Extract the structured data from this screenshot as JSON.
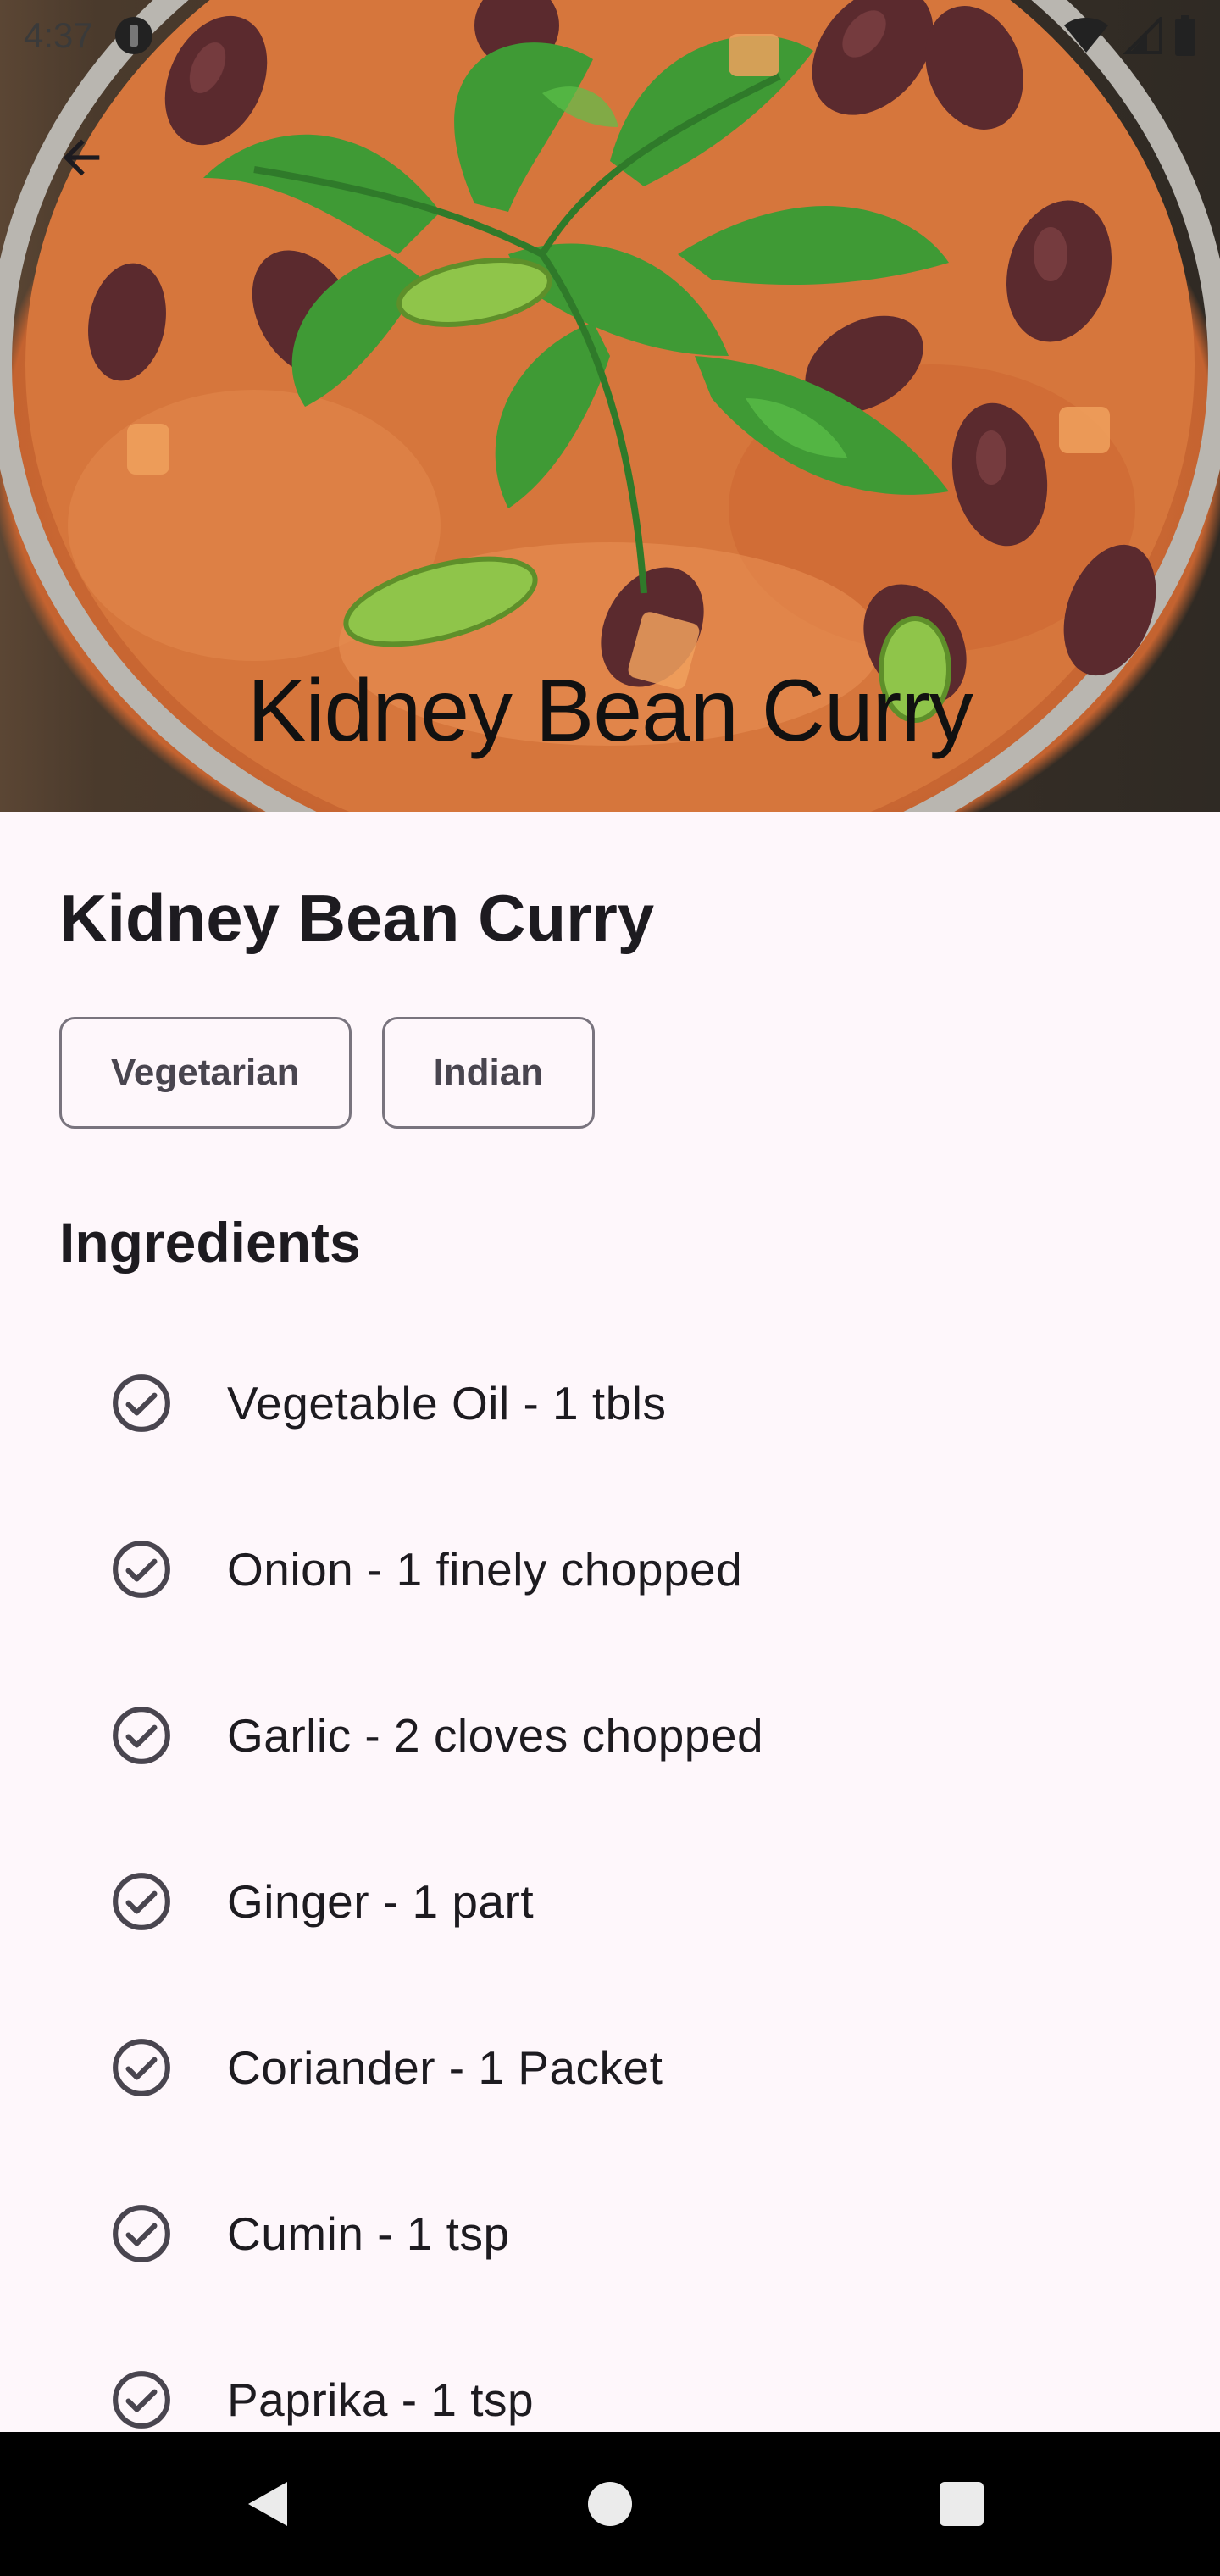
{
  "status_bar": {
    "time": "4:37",
    "icons": [
      "notification-icon",
      "wifi-icon",
      "signal-icon",
      "battery-icon"
    ]
  },
  "hero": {
    "title": "Kidney Bean Curry",
    "image": "kidney-bean-curry-photo"
  },
  "recipe": {
    "title": "Kidney Bean Curry",
    "tags": [
      "Vegetarian",
      "Indian"
    ],
    "ingredients_heading": "Ingredients",
    "ingredients": [
      "Vegetable Oil - 1 tbls",
      "Onion - 1 finely chopped",
      "Garlic - 2 cloves chopped",
      "Ginger - 1 part",
      "Coriander - 1 Packet",
      "Cumin - 1 tsp",
      "Paprika - 1 tsp"
    ]
  },
  "navigation": {
    "back_icon": "arrow-back-icon",
    "system_buttons": [
      "back-triangle-icon",
      "home-circle-icon",
      "recents-square-icon"
    ]
  },
  "colors": {
    "background": "#fef7fb",
    "text": "#1d1b20",
    "chip_border": "#79747e",
    "nav_bar": "#000000"
  }
}
